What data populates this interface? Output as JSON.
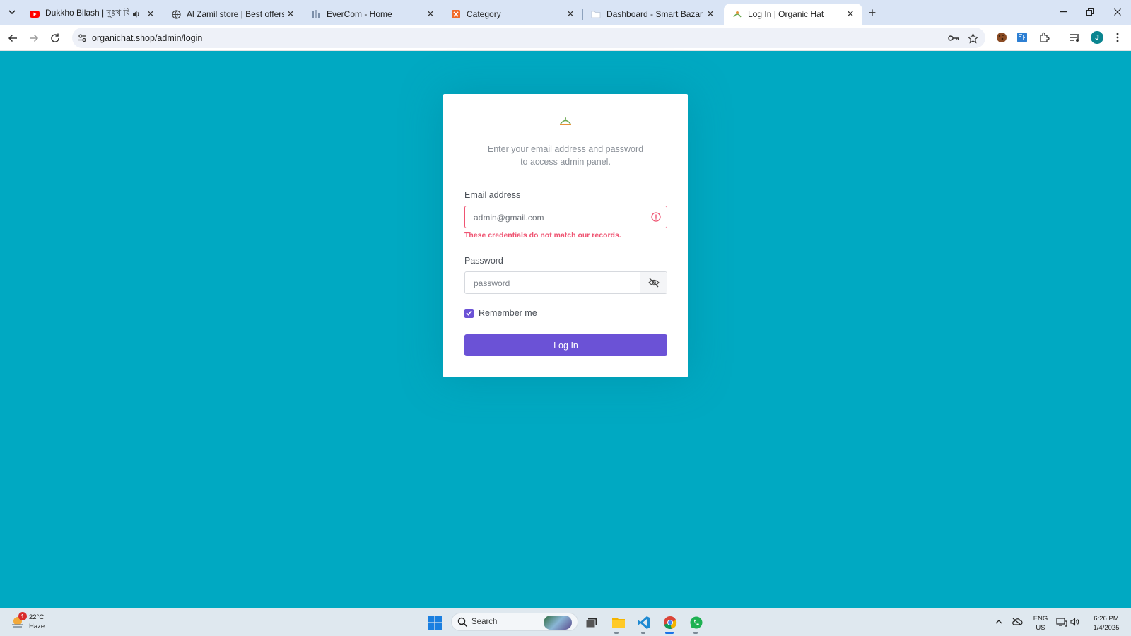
{
  "browser": {
    "tabs": [
      {
        "title": "Dukkho Bilash | দুঃখ বিলাশ |",
        "favicon": "youtube-icon",
        "audio": true,
        "active": false
      },
      {
        "title": "Al Zamil store | Best offers & Di",
        "favicon": "globe-icon",
        "active": false
      },
      {
        "title": "EverCom - Home",
        "favicon": "evercom-icon",
        "active": false
      },
      {
        "title": "Category",
        "favicon": "category-icon",
        "active": false
      },
      {
        "title": "Dashboard - Smart Bazar",
        "favicon": "folder-icon",
        "active": false
      },
      {
        "title": "Log In | Organic Hat",
        "favicon": "organic-hat-icon",
        "active": true
      }
    ],
    "url": "organichat.shop/admin/login"
  },
  "login": {
    "subtitle_line1": "Enter your email address and password",
    "subtitle_line2": "to access admin panel.",
    "email_label": "Email address",
    "email_value": "admin@gmail.com",
    "error_message": "These credentials do not match our records.",
    "password_label": "Password",
    "password_placeholder": "password",
    "remember_label": "Remember me",
    "remember_checked": true,
    "submit_label": "Log In"
  },
  "taskbar": {
    "weather_temp": "22°C",
    "weather_desc": "Haze",
    "weather_badge": "1",
    "search_placeholder": "Search",
    "lang_top": "ENG",
    "lang_bottom": "US",
    "time": "6:26 PM",
    "date": "1/4/2025"
  },
  "colors": {
    "page_bg": "#00a9c2",
    "accent": "#6b52d6",
    "error": "#ef5472"
  }
}
